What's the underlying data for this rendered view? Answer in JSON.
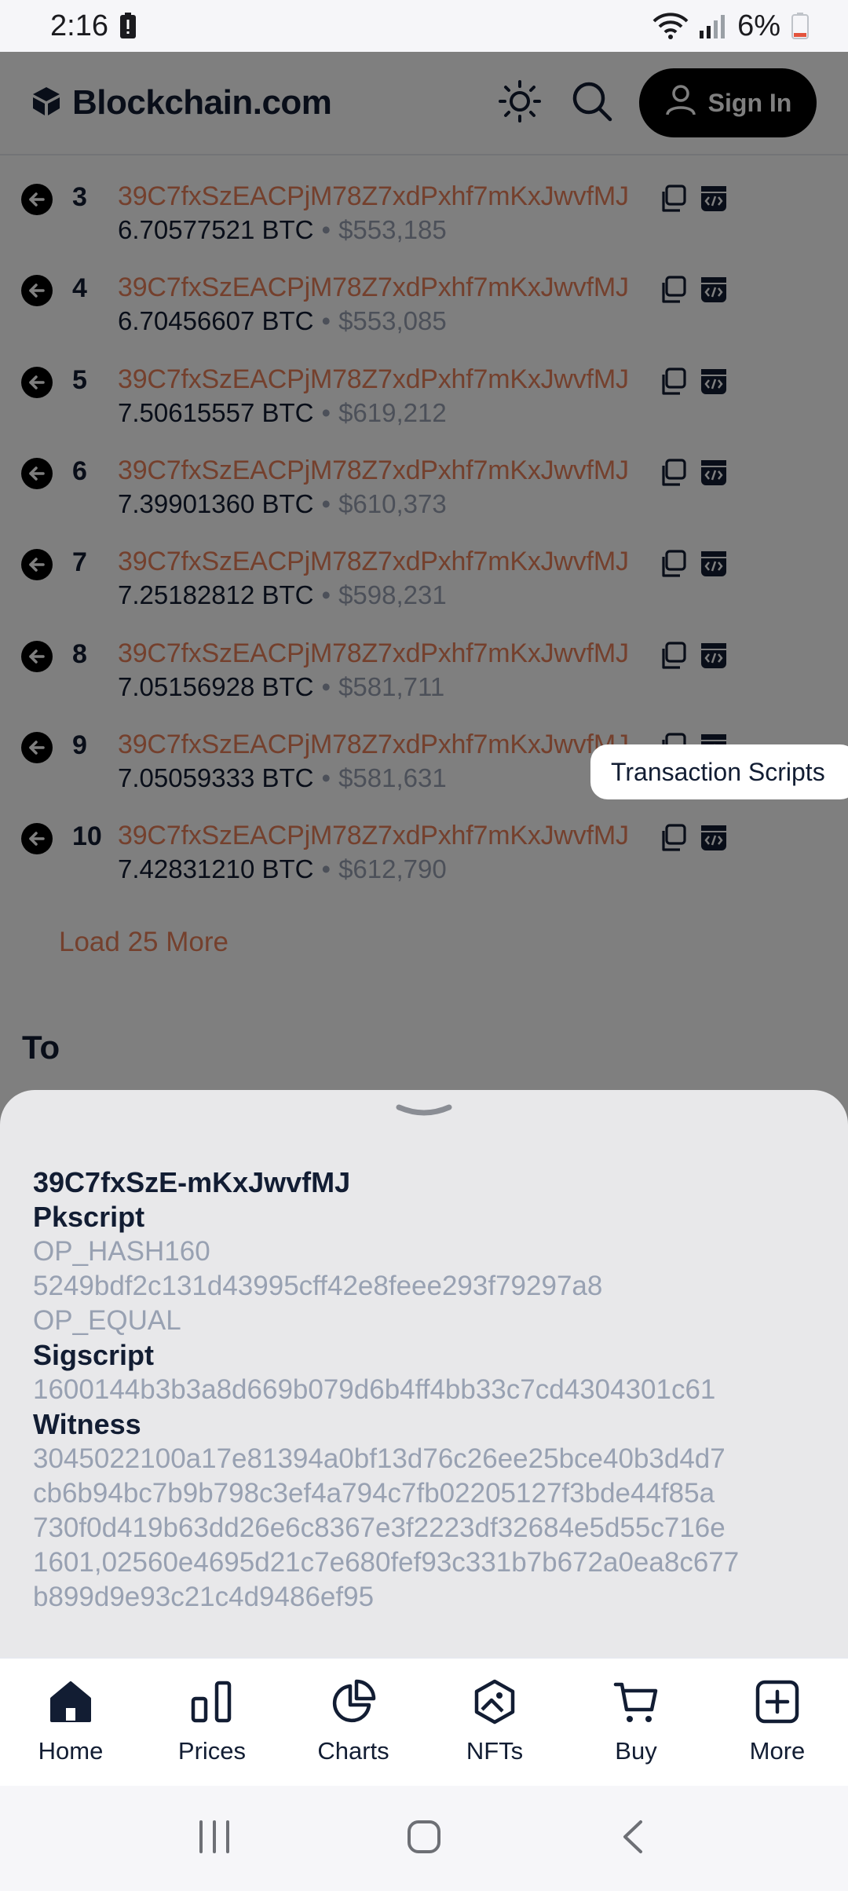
{
  "status_bar": {
    "time": "2:16",
    "battery": "6%"
  },
  "header": {
    "brand": "Blockchain.com",
    "sign_in_label": "Sign In"
  },
  "inputs": [
    {
      "index": "3",
      "address": "39C7fxSzEACPjM78Z7xdPxhf7mKxJwvfMJ",
      "btc": "6.70577521 BTC",
      "usd": "$553,185"
    },
    {
      "index": "4",
      "address": "39C7fxSzEACPjM78Z7xdPxhf7mKxJwvfMJ",
      "btc": "6.70456607 BTC",
      "usd": "$553,085"
    },
    {
      "index": "5",
      "address": "39C7fxSzEACPjM78Z7xdPxhf7mKxJwvfMJ",
      "btc": "7.50615557 BTC",
      "usd": "$619,212"
    },
    {
      "index": "6",
      "address": "39C7fxSzEACPjM78Z7xdPxhf7mKxJwvfMJ",
      "btc": "7.39901360 BTC",
      "usd": "$610,373"
    },
    {
      "index": "7",
      "address": "39C7fxSzEACPjM78Z7xdPxhf7mKxJwvfMJ",
      "btc": "7.25182812 BTC",
      "usd": "$598,231"
    },
    {
      "index": "8",
      "address": "39C7fxSzEACPjM78Z7xdPxhf7mKxJwvfMJ",
      "btc": "7.05156928 BTC",
      "usd": "$581,711"
    },
    {
      "index": "9",
      "address": "39C7fxSzEACPjM78Z7xdPxhf7mKxJwvfMJ",
      "btc": "7.05059333 BTC",
      "usd": "$581,631"
    },
    {
      "index": "10",
      "address": "39C7fxSzEACPjM78Z7xdPxhf7mKxJwvfMJ",
      "btc": "7.42831210 BTC",
      "usd": "$612,790"
    }
  ],
  "amount_separator": "•",
  "load_more_label": "Load 25 More",
  "to_heading": "To",
  "tooltip": "Transaction Scripts",
  "sheet": {
    "address": "39C7fxSzE-mKxJwvfMJ",
    "pkscript_title": "Pkscript",
    "pkscript_value": "OP_HASH160\n5249bdf2c131d43995cff42e8feee293f79297a8\nOP_EQUAL",
    "sigscript_title": "Sigscript",
    "sigscript_value": "1600144b3b3a8d669b079d6b4ff4bb33c7cd4304301c61",
    "witness_title": "Witness",
    "witness_value": "3045022100a17e81394a0bf13d76c26ee25bce40b3d4d7\ncb6b94bc7b9b798c3ef4a794c7fb02205127f3bde44f85a\n730f0d419b63dd26e6c8367e3f2223df32684e5d55c716e\n1601,02560e4695d21c7e680fef93c331b7b672a0ea8c677\nb899d9e93c21c4d9486ef95"
  },
  "bottom_nav": [
    {
      "label": "Home",
      "icon": "home-icon"
    },
    {
      "label": "Prices",
      "icon": "bar-chart-icon"
    },
    {
      "label": "Charts",
      "icon": "pie-chart-icon"
    },
    {
      "label": "NFTs",
      "icon": "nft-icon"
    },
    {
      "label": "Buy",
      "icon": "cart-icon"
    },
    {
      "label": "More",
      "icon": "plus-square-icon"
    }
  ],
  "colors": {
    "accent": "#e9805a",
    "muted": "#98a1b2",
    "text": "#121d33"
  }
}
